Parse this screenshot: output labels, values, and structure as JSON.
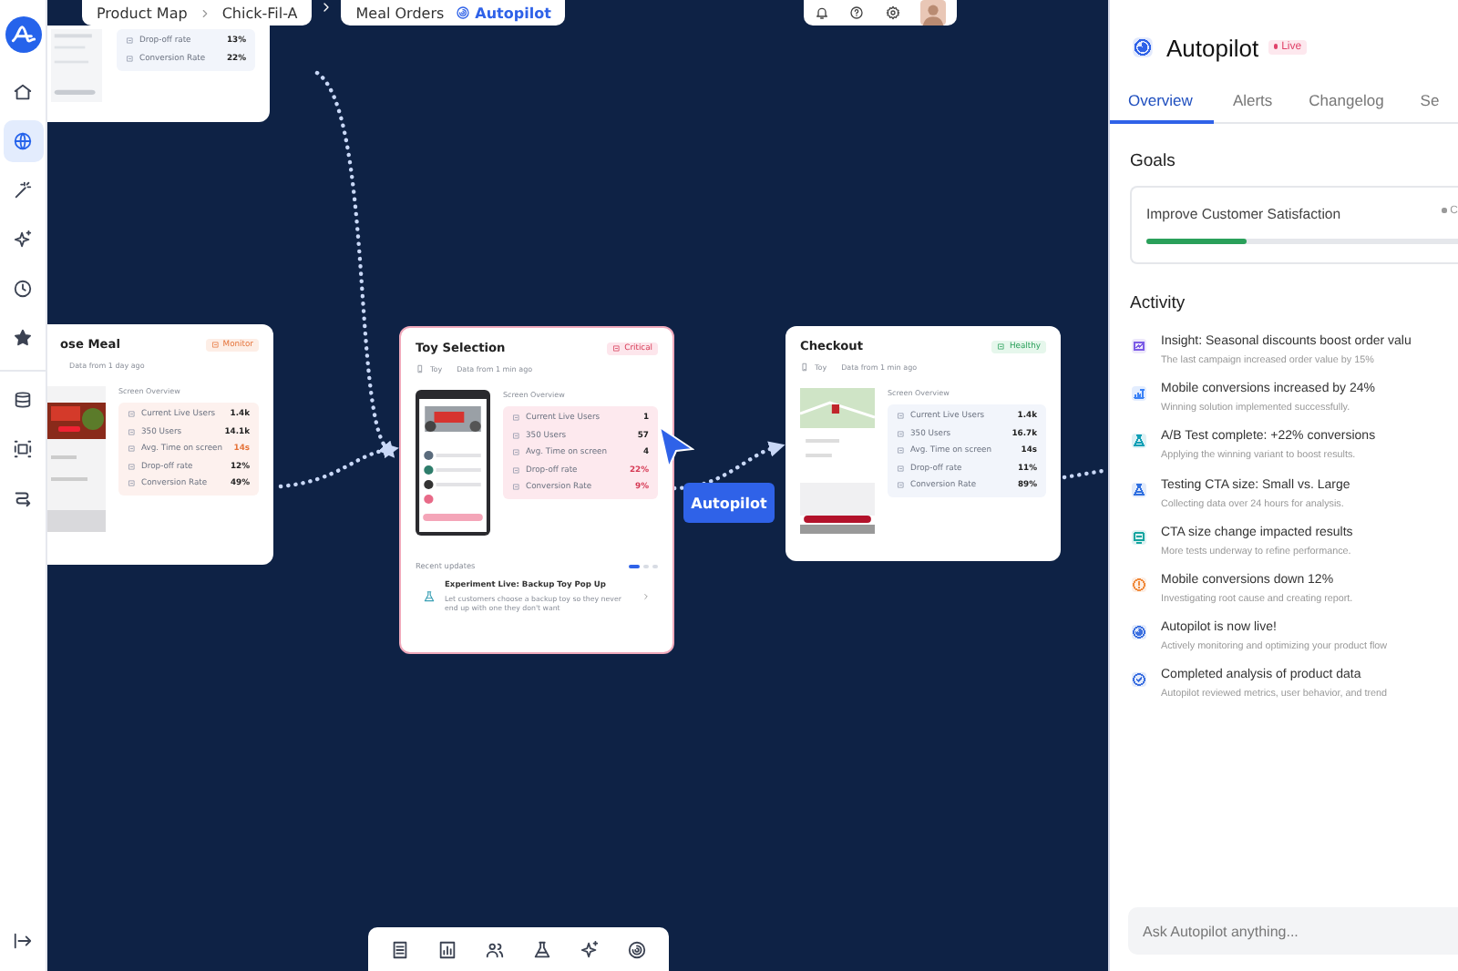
{
  "sidebar": {
    "primary": [
      {
        "kind": "home",
        "selected": false
      },
      {
        "kind": "globe",
        "selected": true
      },
      {
        "kind": "wand",
        "selected": false
      },
      {
        "kind": "sparkle",
        "selected": false
      },
      {
        "kind": "clock",
        "selected": false
      },
      {
        "kind": "star",
        "selected": false
      }
    ],
    "secondary": [
      {
        "kind": "database",
        "selected": false
      },
      {
        "kind": "frame",
        "selected": false
      },
      {
        "kind": "flow",
        "selected": false
      }
    ]
  },
  "breadcrumb": {
    "items": [
      "Product Map",
      "Chick-Fil-A"
    ],
    "section": "Meal Orders",
    "active": "Autopilot"
  },
  "top_bar_icons": [
    {
      "kind": "bell"
    },
    {
      "kind": "help"
    },
    {
      "kind": "gear"
    },
    {
      "kind": "avatar"
    }
  ],
  "partial_card": {
    "metrics": [
      {
        "label": "Drop-off rate",
        "value": "13%"
      },
      {
        "label": "Conversion Rate",
        "value": "22%"
      }
    ]
  },
  "nodes": [
    {
      "title": "ose Meal",
      "status": {
        "label": "Monitor",
        "kind": "warning"
      },
      "updated": "Data from 1 day ago",
      "overview_title": "Screen Overview",
      "metrics": [
        {
          "label": "Current Live Users",
          "value": "1.4k",
          "alert": false
        },
        {
          "label": "350 Users",
          "value": "14.1k",
          "alert": false
        },
        {
          "label": "Avg. Time on screen",
          "value": "14s",
          "alert": true
        },
        {
          "label": "Drop-off rate",
          "value": "12%",
          "alert": false
        },
        {
          "label": "Conversion Rate",
          "value": "49%",
          "alert": false
        }
      ]
    },
    {
      "title": "Toy Selection",
      "status": {
        "label": "Critical",
        "kind": "critical"
      },
      "device": "Toy",
      "updated": "Data from 1 min ago",
      "overview_title": "Screen Overview",
      "metrics": [
        {
          "label": "Current Live Users",
          "value": "1",
          "alert": false
        },
        {
          "label": "350 Users",
          "value": "57",
          "alert": false
        },
        {
          "label": "Avg. Time on screen",
          "value": "4",
          "alert": false
        },
        {
          "label": "Drop-off rate",
          "value": "22%",
          "alert": true
        },
        {
          "label": "Conversion Rate",
          "value": "9%",
          "alert": true
        }
      ],
      "updates": {
        "title": "Recent updates",
        "pages": [
          {
            "selected": true
          },
          {
            "selected": false
          },
          {
            "selected": false
          }
        ],
        "items": [
          {
            "title": "Experiment Live: Backup Toy Pop Up",
            "description": "Let customers choose a backup toy so they never end up with one they don't want"
          }
        ]
      }
    },
    {
      "title": "Checkout",
      "status": {
        "label": "Healthy",
        "kind": "healthy"
      },
      "device": "Toy",
      "updated": "Data from 1 min ago",
      "overview_title": "Screen Overview",
      "metrics": [
        {
          "label": "Current Live Users",
          "value": "1.4k",
          "alert": false
        },
        {
          "label": "350 Users",
          "value": "16.7k",
          "alert": false
        },
        {
          "label": "Avg. Time on screen",
          "value": "14s",
          "alert": false
        },
        {
          "label": "Drop-off rate",
          "value": "11%",
          "alert": false
        },
        {
          "label": "Conversion Rate",
          "value": "89%",
          "alert": false
        }
      ]
    }
  ],
  "flow_label": "Autopilot",
  "bottom_toolbar": [
    {
      "kind": "list"
    },
    {
      "kind": "chart"
    },
    {
      "kind": "users"
    },
    {
      "kind": "flask"
    },
    {
      "kind": "sparkle"
    },
    {
      "kind": "spiral"
    }
  ],
  "panel": {
    "title": "Autopilot",
    "badge": "Live",
    "tabs": [
      {
        "label": "Overview",
        "selected": true
      },
      {
        "label": "Alerts",
        "selected": false
      },
      {
        "label": "Changelog",
        "selected": false
      },
      {
        "label": "Se",
        "selected": false
      }
    ],
    "goals": {
      "title": "Goals",
      "items": [
        {
          "label": "Improve Customer Satisfaction",
          "status": "C",
          "level": 0.32
        }
      ]
    },
    "activity": {
      "title": "Activity",
      "items": [
        {
          "kind": "insight",
          "color": "#7c5ce6",
          "title": "Insight: Seasonal discounts boost order valu",
          "description": "The last campaign increased order value by 15%"
        },
        {
          "kind": "trend",
          "color": "#3b82f6",
          "title": "Mobile conversions increased by 24%",
          "description": "Winning solution implemented successfully."
        },
        {
          "kind": "flask",
          "color": "#0f9fb5",
          "title": "A/B Test complete: +22% conversions",
          "description": "Applying the winning variant to boost results."
        },
        {
          "kind": "flask",
          "color": "#2f6fe0",
          "title": "Testing CTA size: Small vs. Large",
          "description": "Collecting data over 24 hours for analysis."
        },
        {
          "kind": "screen",
          "color": "#14a5a0",
          "title": "CTA size change impacted results",
          "description": "More tests underway to refine performance."
        },
        {
          "kind": "alert",
          "color": "#f08a3c",
          "title": "Mobile conversions down 12%",
          "description": "Investigating root cause and creating report."
        },
        {
          "kind": "spiral",
          "color": "#3b6fe0",
          "title": "Autopilot is now live!",
          "description": "Actively monitoring and optimizing your product flow"
        },
        {
          "kind": "check",
          "color": "#3b6fe0",
          "title": "Completed analysis of product data",
          "description": "Autopilot reviewed metrics, user behavior, and trend"
        }
      ]
    },
    "input": {
      "placeholder": "Ask Autopilot anything..."
    }
  }
}
